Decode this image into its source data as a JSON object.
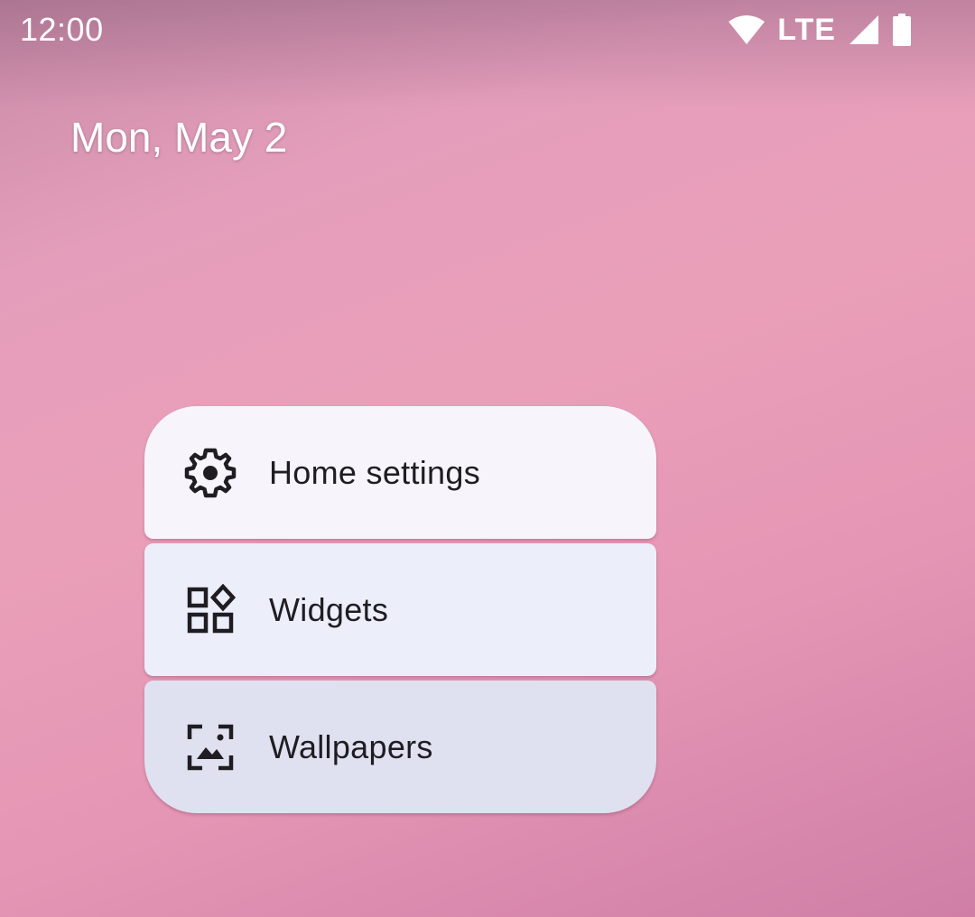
{
  "status_bar": {
    "time": "12:00",
    "network_label": "LTE",
    "icons": [
      "wifi-icon",
      "cellular-signal-icon",
      "battery-icon"
    ]
  },
  "home": {
    "date": "Mon, May 2"
  },
  "menu": {
    "items": [
      {
        "label": "Home settings",
        "icon": "gear-icon"
      },
      {
        "label": "Widgets",
        "icon": "widgets-icon"
      },
      {
        "label": "Wallpapers",
        "icon": "wallpaper-icon"
      }
    ]
  },
  "colors": {
    "menu_item_1_bg": "#f7f5fb",
    "menu_item_2_bg": "#eceefa",
    "menu_item_3_bg": "#dfe1f0",
    "text": "#1f1d22"
  }
}
